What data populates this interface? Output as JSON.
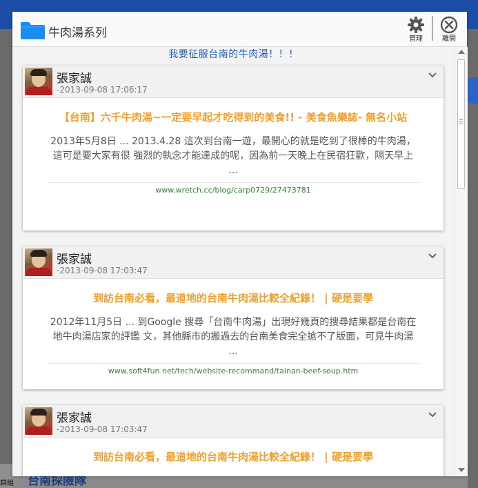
{
  "background": {
    "group_label": "群組",
    "team_title": "台南探險隊"
  },
  "modal": {
    "title": "牛肉湯系列",
    "manage_label": "管理",
    "leave_label": "離開",
    "album_caption": "我要征服台南的牛肉湯！！！"
  },
  "posts": [
    {
      "user": "張家誠",
      "time": "-2013-09-08 17:06:17",
      "link_title": "【台南】六千牛肉湯~一定要早起才吃得到的美食!! - 美食魚樂誌- 無名小站",
      "snippet": "2013年5月8日 ... 2013.4.28 這次到台南一遊，最開心的就是吃到了很棒的牛肉湯，這可是要大家有很 強烈的執念才能達成的呢，因為前一天晚上在民宿狂歡，隔天早上 ...",
      "url": "www.wretch.cc/blog/carp0729/27473781"
    },
    {
      "user": "張家誠",
      "time": "-2013-09-08 17:03:47",
      "link_title": "到訪台南必看，最道地的台南牛肉湯比較全紀錄！ | 硬是要學",
      "snippet": "2012年11月5日 ... 到Google 搜尋「台南牛肉湯」出現好幾頁的搜尋結果都是台南在地牛肉湯店家的評鑑 文，其他縣市的搬過去的台南美食完全搶不了版面，可見牛肉湯 ...",
      "url": "www.soft4fun.net/tech/website-recommand/tainan-beef-soup.htm"
    },
    {
      "user": "張家誠",
      "time": "-2013-09-08 17:03:47",
      "link_title": "到訪台南必看，最道地的台南牛肉湯比較全紀錄！ | 硬是要學"
    }
  ],
  "colors": {
    "accent_blue": "#1d5fb5",
    "link_orange": "#f0a02a",
    "url_green": "#2f8a2f"
  },
  "icons": {
    "folder": "folder-icon",
    "manage": "gear-icon",
    "leave": "close-circle-icon",
    "expand": "chevron-down-icon"
  }
}
